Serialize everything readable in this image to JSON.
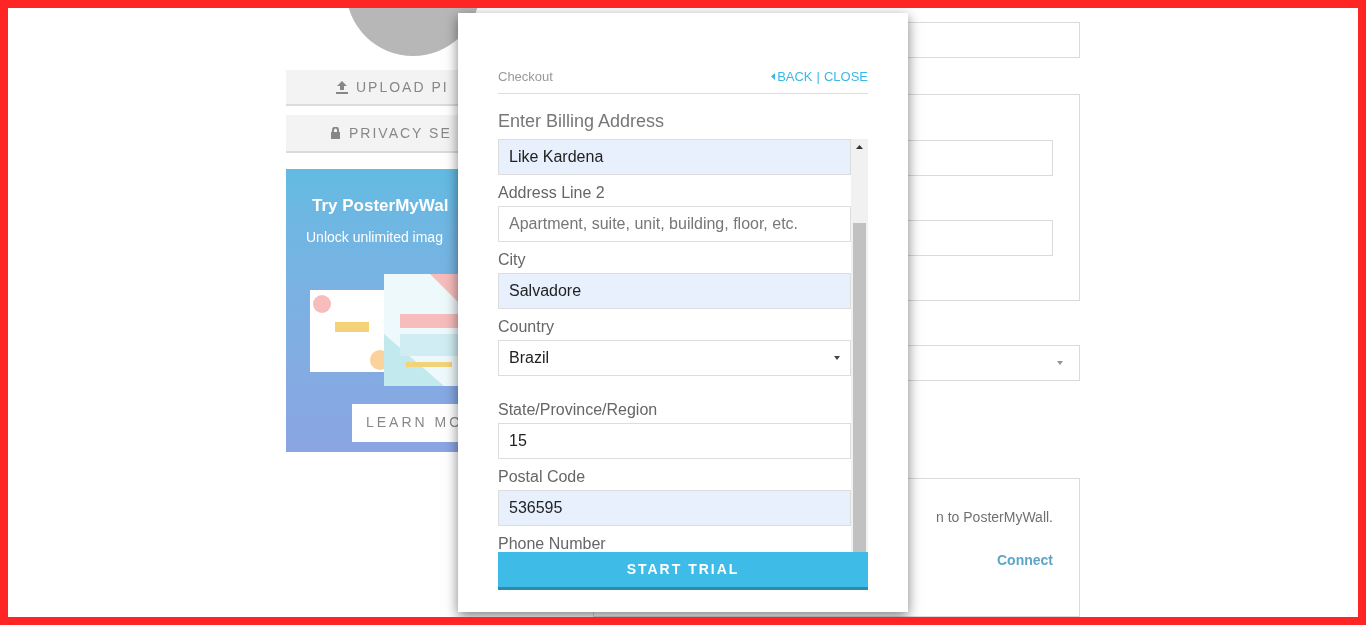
{
  "background": {
    "upload_button": "UPLOAD PI",
    "privacy_button": "PRIVACY SE",
    "promo": {
      "title": "Try PosterMyWal",
      "subtitle": "Unlock unlimited imag",
      "button": "LEARN MO"
    },
    "connect_text": "n to PosterMyWall.",
    "connect_link": "Connect"
  },
  "modal": {
    "title": "Checkout",
    "back": "BACK",
    "separator": "|",
    "close": "CLOSE",
    "heading": "Enter Billing Address",
    "fields": [
      {
        "kind": "input",
        "value": "Like Kardena",
        "autofilled": true
      },
      {
        "kind": "input",
        "label": "Address Line 2",
        "placeholder": "Apartment, suite, unit, building, floor, etc.",
        "autofilled": false
      },
      {
        "kind": "input",
        "label": "City",
        "value": "Salvadore",
        "autofilled": true
      },
      {
        "kind": "select",
        "label": "Country",
        "value": "Brazil",
        "autofilled": false
      },
      {
        "kind": "input",
        "label": "State/Province/Region",
        "value": "15",
        "autofilled": false
      },
      {
        "kind": "input",
        "label": "Postal Code",
        "value": "536595",
        "autofilled": true
      },
      {
        "kind": "label",
        "label": "Phone Number"
      }
    ],
    "submit": "START TRIAL"
  }
}
